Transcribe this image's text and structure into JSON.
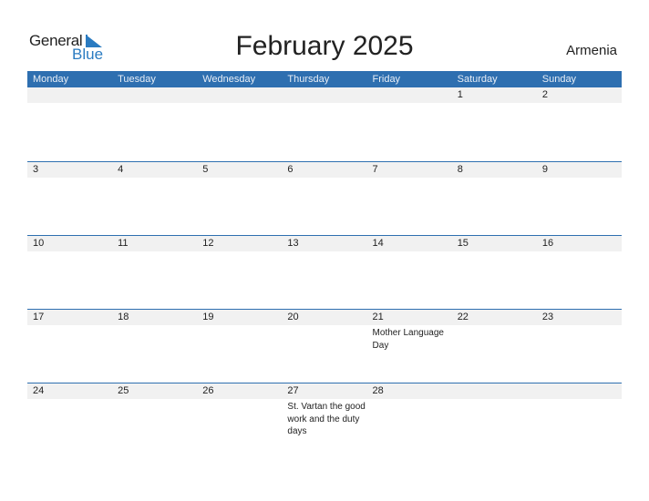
{
  "logo": {
    "general": "General",
    "blue": "Blue",
    "icon": "triangle-flag-icon"
  },
  "title": "February 2025",
  "country": "Armenia",
  "accent_color": "#2e6fb0",
  "weekdays": [
    "Monday",
    "Tuesday",
    "Wednesday",
    "Thursday",
    "Friday",
    "Saturday",
    "Sunday"
  ],
  "weeks": [
    [
      {
        "day": ""
      },
      {
        "day": ""
      },
      {
        "day": ""
      },
      {
        "day": ""
      },
      {
        "day": ""
      },
      {
        "day": "1"
      },
      {
        "day": "2"
      }
    ],
    [
      {
        "day": "3"
      },
      {
        "day": "4"
      },
      {
        "day": "5"
      },
      {
        "day": "6"
      },
      {
        "day": "7"
      },
      {
        "day": "8"
      },
      {
        "day": "9"
      }
    ],
    [
      {
        "day": "10"
      },
      {
        "day": "11"
      },
      {
        "day": "12"
      },
      {
        "day": "13"
      },
      {
        "day": "14"
      },
      {
        "day": "15"
      },
      {
        "day": "16"
      }
    ],
    [
      {
        "day": "17"
      },
      {
        "day": "18"
      },
      {
        "day": "19"
      },
      {
        "day": "20"
      },
      {
        "day": "21",
        "event": "Mother Language Day"
      },
      {
        "day": "22"
      },
      {
        "day": "23"
      }
    ],
    [
      {
        "day": "24"
      },
      {
        "day": "25"
      },
      {
        "day": "26"
      },
      {
        "day": "27",
        "event": "St. Vartan the good work and the duty days"
      },
      {
        "day": "28"
      },
      {
        "day": ""
      },
      {
        "day": ""
      }
    ]
  ]
}
